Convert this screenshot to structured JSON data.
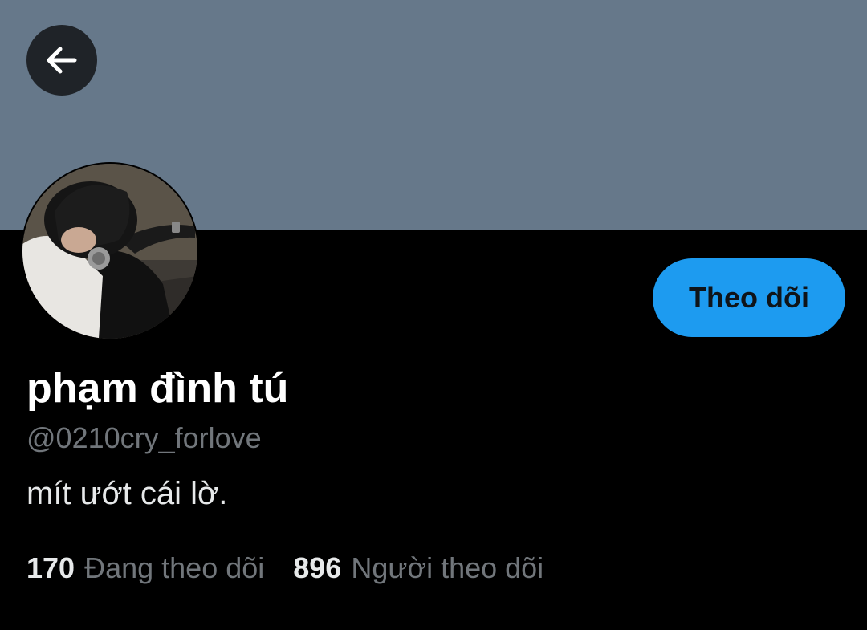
{
  "profile": {
    "banner_color": "#66788a",
    "back_icon": "arrow-left-icon",
    "avatar": "profile-photo",
    "display_name": "phạm đình tú",
    "handle": "@0210cry_forlove",
    "bio": "mít ướt cái lờ.",
    "follow_label": "Theo dõi",
    "following_count": "170",
    "following_label": "Đang theo dõi",
    "followers_count": "896",
    "followers_label": "Người theo dõi"
  },
  "colors": {
    "accent": "#1d9bf0",
    "background": "#000000",
    "muted_text": "#71767b"
  }
}
